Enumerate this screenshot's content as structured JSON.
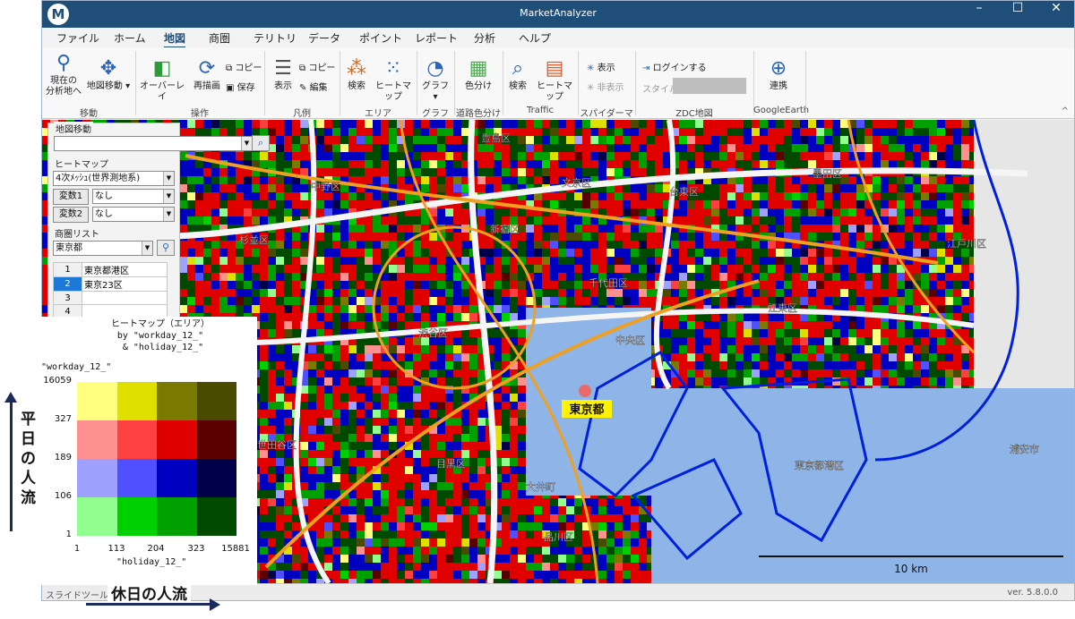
{
  "window": {
    "title": "MarketAnalyzer",
    "controls": [
      "–",
      "☐",
      "✕"
    ]
  },
  "menu": [
    "ファイル",
    "ホーム",
    "地図",
    "商圏",
    "テリトリ",
    "データ",
    "ポイント",
    "レポート",
    "分析",
    "ヘルプ"
  ],
  "active_menu": "地図",
  "ribbon": {
    "move": {
      "current": "現在の\n分析地へ",
      "map_move": "地図移動 ▾",
      "group": "移動"
    },
    "ops": {
      "overlay": "オーバーレイ",
      "redraw": "再描画",
      "copy": "コピー",
      "save": "保存",
      "group": "操作"
    },
    "legend": {
      "show": "表示",
      "copy": "コピー",
      "edit": "編集",
      "group": "凡例"
    },
    "area": {
      "search": "検索",
      "heatmap": "ヒートマップ",
      "group": "エリア"
    },
    "graph": {
      "graph": "グラフ ▾",
      "group": "グラフ"
    },
    "road": {
      "color": "色分け",
      "group": "道路色分け"
    },
    "traffic": {
      "search": "検索",
      "heatmap": "ヒートマップ",
      "group": "Traffic"
    },
    "spider": {
      "show": "表示",
      "hide": "非表示",
      "group": "スパイダーマップ"
    },
    "zdc": {
      "login": "ログインする",
      "style": "スタイル",
      "group": "ZDC地図"
    },
    "ge": {
      "link": "連携",
      "group": "GoogleEarth"
    },
    "collapse": "^"
  },
  "panel": {
    "map_move_label": "地図移動",
    "heatmap_label": "ヒートマップ",
    "mesh": "4次ﾒｯｼｭ(世界測地系)",
    "var1_button": "変数1",
    "var1_value": "なし",
    "var2_button": "変数2",
    "var2_value": "なし",
    "area_list_label": "商圏リスト",
    "prefecture": "東京都",
    "rows": [
      {
        "no": "1",
        "name": "東京都港区"
      },
      {
        "no": "2",
        "name": "東京23区"
      },
      {
        "no": "3",
        "name": ""
      },
      {
        "no": "4",
        "name": ""
      }
    ]
  },
  "map": {
    "labels": [
      "豊島区",
      "文京区",
      "中野区",
      "台東区",
      "墨田区",
      "杉並区",
      "新宿区",
      "江戸川区",
      "千代田区",
      "江東区",
      "渋谷区",
      "中央区",
      "東京都",
      "目黒区",
      "品川区",
      "世田谷区",
      "東京都港区",
      "大井町",
      "浦安市"
    ],
    "scale_label": "10 km",
    "accent_label": "東京都"
  },
  "legend": {
    "title": "ヒートマップ（エリア）\nby \"workday_12_\"\n & \"holiday_12_\"",
    "y_name": "\"workday_12_\"",
    "x_name": "\"holiday_12_\"",
    "y_ticks": [
      "16059",
      "327",
      "189",
      "106",
      "1"
    ],
    "x_ticks": [
      "1",
      "113",
      "204",
      "323",
      "15881"
    ],
    "colors": [
      [
        "#ffff80",
        "#e0e000",
        "#7a7a00",
        "#4a4a00"
      ],
      [
        "#ff9090",
        "#ff4040",
        "#e00000",
        "#5a0000"
      ],
      [
        "#a0a0ff",
        "#5050ff",
        "#0000c0",
        "#00004a"
      ],
      [
        "#90ff90",
        "#00d000",
        "#00a000",
        "#004a00"
      ]
    ]
  },
  "captions": {
    "y": "平日の人流",
    "x": "休日の人流"
  },
  "status": {
    "tool": "スライドツール",
    "version": "ver. 5.8.0.0"
  }
}
